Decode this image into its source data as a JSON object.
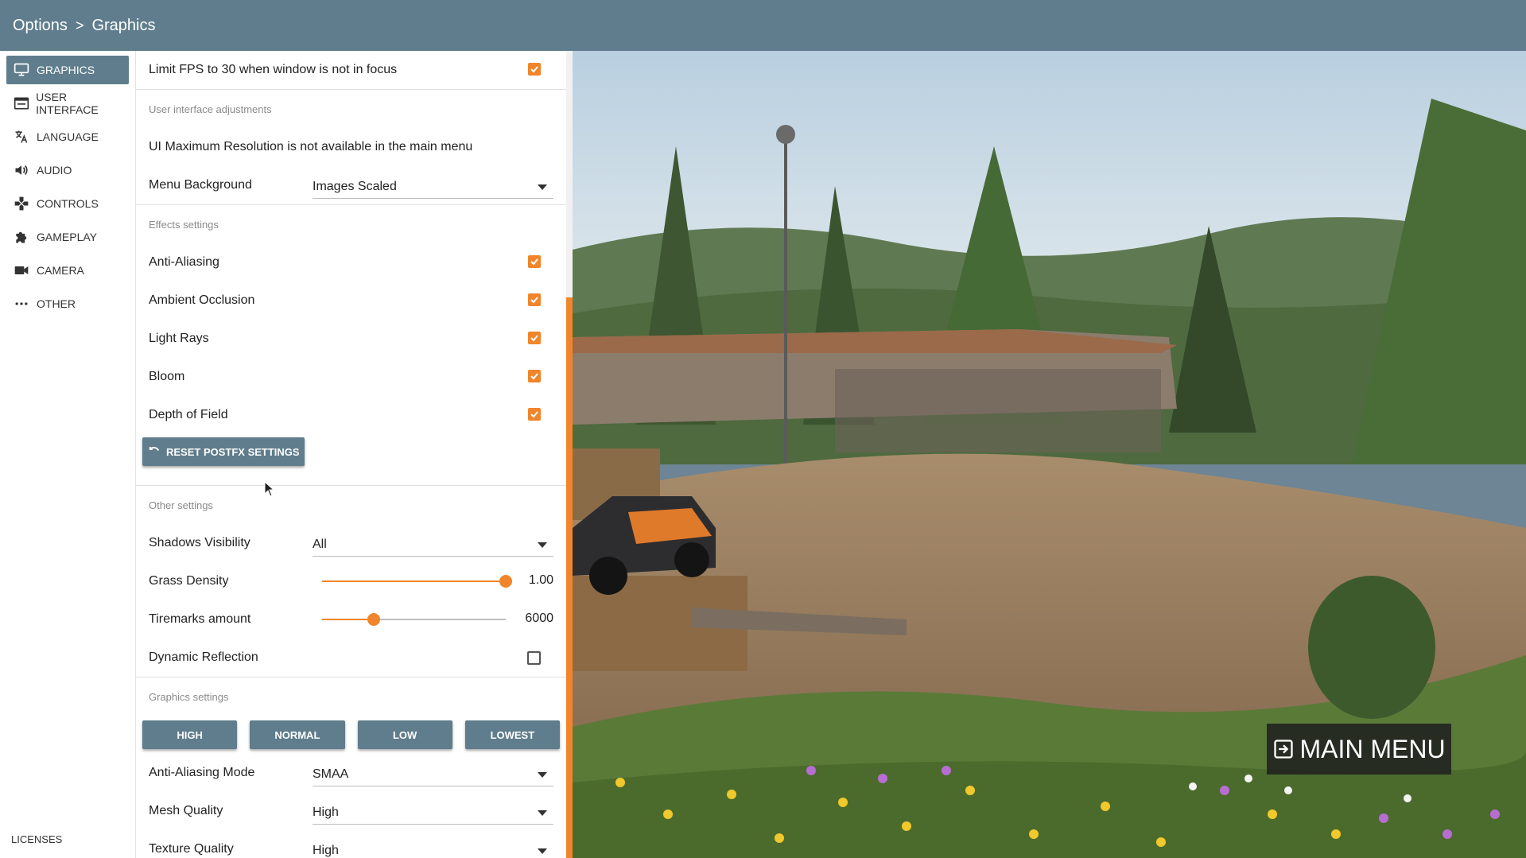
{
  "breadcrumb": {
    "root": "Options",
    "separator": ">",
    "current": "Graphics"
  },
  "sidebar": {
    "items": [
      {
        "label": "GRAPHICS",
        "icon": "monitor-icon",
        "active": true
      },
      {
        "label": "USER INTERFACE",
        "icon": "window-icon",
        "active": false
      },
      {
        "label": "LANGUAGE",
        "icon": "translate-icon",
        "active": false
      },
      {
        "label": "AUDIO",
        "icon": "speaker-icon",
        "active": false
      },
      {
        "label": "CONTROLS",
        "icon": "gamepad-icon",
        "active": false
      },
      {
        "label": "GAMEPLAY",
        "icon": "puzzle-icon",
        "active": false
      },
      {
        "label": "CAMERA",
        "icon": "videocam-icon",
        "active": false
      },
      {
        "label": "OTHER",
        "icon": "more-icon",
        "active": false
      }
    ],
    "licenses": "LICENSES"
  },
  "settings": {
    "limit_fps": {
      "label": "Limit FPS to 30 when window is not in focus",
      "checked": true
    },
    "ui_section": "User interface adjustments",
    "ui_max_res_note": "UI Maximum Resolution is not available in the main menu",
    "menu_background": {
      "label": "Menu Background",
      "value": "Images Scaled"
    },
    "effects_section": "Effects settings",
    "anti_aliasing": {
      "label": "Anti-Aliasing",
      "checked": true
    },
    "ambient_occlusion": {
      "label": "Ambient Occlusion",
      "checked": true
    },
    "light_rays": {
      "label": "Light Rays",
      "checked": true
    },
    "bloom": {
      "label": "Bloom",
      "checked": true
    },
    "depth_of_field": {
      "label": "Depth of Field",
      "checked": true
    },
    "reset_postfx": "RESET POSTFX SETTINGS",
    "other_section": "Other settings",
    "shadows_visibility": {
      "label": "Shadows Visibility",
      "value": "All"
    },
    "grass_density": {
      "label": "Grass Density",
      "value": "1.00",
      "fraction": 1.0
    },
    "tiremarks": {
      "label": "Tiremarks amount",
      "value": "6000",
      "fraction": 0.28
    },
    "dynamic_reflection": {
      "label": "Dynamic Reflection",
      "checked": false
    },
    "graphics_section": "Graphics settings",
    "presets": [
      "HIGH",
      "NORMAL",
      "LOW",
      "LOWEST"
    ],
    "aa_mode": {
      "label": "Anti-Aliasing Mode",
      "value": "SMAA"
    },
    "mesh_quality": {
      "label": "Mesh Quality",
      "value": "High"
    },
    "texture_quality": {
      "label": "Texture Quality",
      "value": "High"
    }
  },
  "main_menu": {
    "label": "MAIN MENU",
    "icon": "exit-icon"
  },
  "colors": {
    "accent": "#f0852b",
    "header": "#5f7d8c"
  }
}
